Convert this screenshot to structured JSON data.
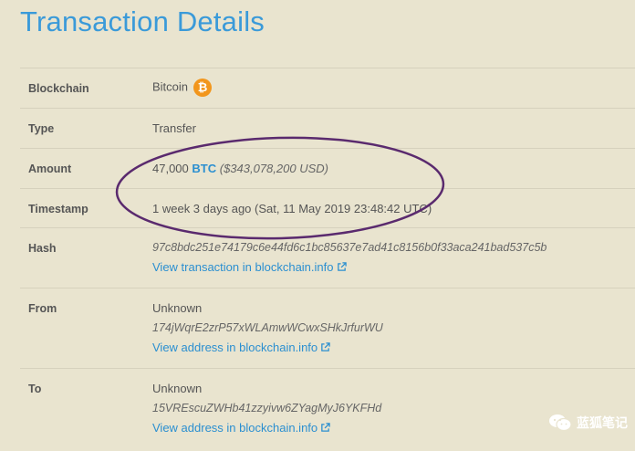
{
  "page": {
    "title": "Transaction Details"
  },
  "blockchain": {
    "label": "Blockchain",
    "value": "Bitcoin",
    "icon": "bitcoin-icon",
    "icon_glyph": "₿",
    "icon_color": "#f2961c"
  },
  "type": {
    "label": "Type",
    "value": "Transfer"
  },
  "amount": {
    "label": "Amount",
    "value": "47,000",
    "currency": "BTC",
    "usd": "($343,078,200 USD)"
  },
  "timestamp": {
    "label": "Timestamp",
    "value": "1 week 3 days ago (Sat, 11 May 2019 23:48:42 UTC)"
  },
  "hash": {
    "label": "Hash",
    "value": "97c8bdc251e74179c6e44fd6c1bc85637e7ad41c8156b0f33aca241bad537c5b",
    "link": "View transaction in blockchain.info"
  },
  "from": {
    "label": "From",
    "owner": "Unknown",
    "address": "174jWqrE2zrP57xWLAmwWCwxSHkJrfurWU",
    "link": "View address in blockchain.info"
  },
  "to": {
    "label": "To",
    "owner": "Unknown",
    "address": "15VREscuZWHb41zzyivw6ZYagMyJ6YKFHd",
    "link": "View address in blockchain.info"
  },
  "watermark": {
    "text": "蓝狐笔记"
  },
  "colors": {
    "background": "#e9e4cf",
    "title": "#3a9ad9",
    "link": "#2b8fd0",
    "annotation": "#5a2a6e"
  }
}
